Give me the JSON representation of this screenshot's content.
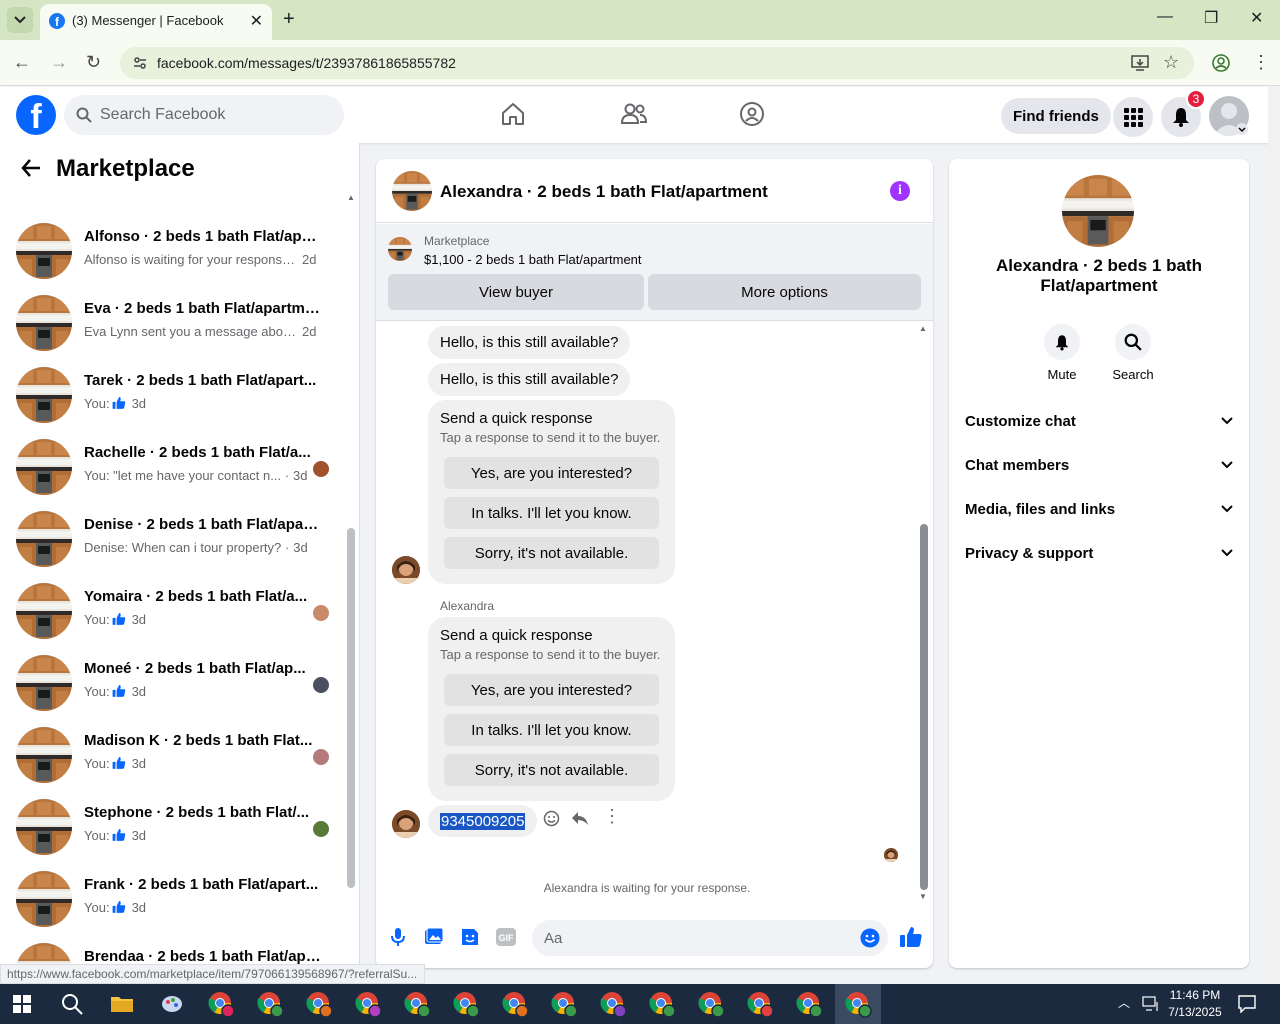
{
  "browser": {
    "tab_title": "(3) Messenger | Facebook",
    "url": "facebook.com/messages/t/23937861865855782"
  },
  "header": {
    "search_placeholder": "Search Facebook",
    "find_friends": "Find friends",
    "notification_count": "3"
  },
  "sidebar": {
    "title": "Marketplace",
    "conversations": [
      {
        "name": "Alfonso · 2 beds 1 bath Flat/apar...",
        "preview": "Alfonso is waiting for your response. ·",
        "time": "2d",
        "like": false,
        "mini_avatar": ""
      },
      {
        "name": "Eva · 2 beds 1 bath Flat/apartment",
        "preview": "Eva Lynn sent you a message about... ·",
        "time": "2d",
        "like": false,
        "mini_avatar": ""
      },
      {
        "name": "Tarek · 2 beds 1 bath Flat/apart...",
        "preview": "You:",
        "time": "3d",
        "like": true,
        "mini_avatar": ""
      },
      {
        "name": "Rachelle · 2 beds 1 bath Flat/a...",
        "preview": "You: \"let me have your contact n... ·",
        "time": "3d",
        "like": false,
        "mini_avatar": "#a0522d"
      },
      {
        "name": "Denise · 2 beds 1 bath Flat/apart...",
        "preview": "Denise: When can i tour property? ·",
        "time": "3d",
        "like": false,
        "mini_avatar": ""
      },
      {
        "name": "Yomaira · 2 beds 1 bath Flat/a...",
        "preview": "You:",
        "time": "3d",
        "like": true,
        "mini_avatar": "#c98a6b"
      },
      {
        "name": "Moneé · 2 beds 1 bath Flat/ap...",
        "preview": "You:",
        "time": "3d",
        "like": true,
        "mini_avatar": "#4a5060"
      },
      {
        "name": "Madison K · 2 beds 1 bath Flat...",
        "preview": "You:",
        "time": "3d",
        "like": true,
        "mini_avatar": "#b57a7a"
      },
      {
        "name": "Stephone · 2 beds 1 bath Flat/...",
        "preview": "You:",
        "time": "3d",
        "like": true,
        "mini_avatar": "#5a7a3a"
      },
      {
        "name": "Frank · 2 beds 1 bath Flat/apart...",
        "preview": "You:",
        "time": "3d",
        "like": true,
        "mini_avatar": ""
      },
      {
        "name": "Brendaa · 2 beds 1 bath Flat/apa...",
        "preview": "You: Yes its still available Please sen... ·",
        "time": "3d",
        "like": false,
        "mini_avatar": ""
      }
    ],
    "status_link": "https://www.facebook.com/marketplace/item/797066139568967/?referralSu..."
  },
  "chat": {
    "title": "Alexandra · 2 beds 1 bath Flat/apartment",
    "marketplace_label": "Marketplace",
    "listing": "$1,100 - 2 beds 1 bath Flat/apartment",
    "view_buyer": "View buyer",
    "more_options": "More options",
    "messages": [
      "Hello, is this still available?",
      "Hello, is this still available?"
    ],
    "quick_response": {
      "heading": "Send a quick response",
      "subtext": "Tap a response to send it to the buyer.",
      "options": [
        "Yes, are you interested?",
        "In talks. I'll let you know.",
        "Sorry, it's not available."
      ]
    },
    "sender_name": "Alexandra",
    "phone_message": "9345009205",
    "waiting_text": "Alexandra is waiting for your response.",
    "composer_placeholder": "Aa"
  },
  "details": {
    "title": "Alexandra · 2 beds 1 bath Flat/apartment",
    "mute": "Mute",
    "search": "Search",
    "sections": [
      "Customize chat",
      "Chat members",
      "Media, files and links",
      "Privacy & support"
    ]
  },
  "taskbar": {
    "time": "11:46 PM",
    "date": "7/13/2025"
  },
  "colors": {
    "brand": "#0866ff",
    "accent_purple": "#a033ff",
    "badge": "#e41e3f"
  }
}
